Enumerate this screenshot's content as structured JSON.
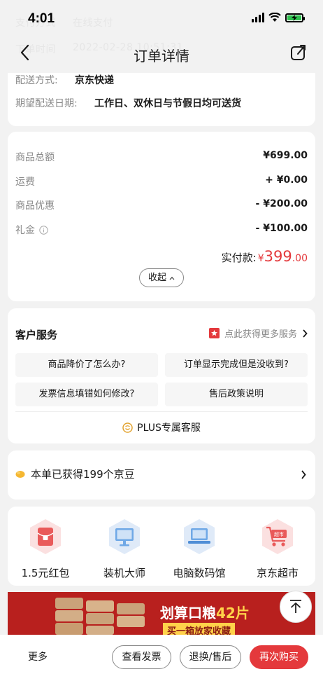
{
  "status_bar": {
    "time": "4:01"
  },
  "ghost": {
    "pay_label": "支付方式",
    "pay_value": "在线支付",
    "time_label": "下单时间",
    "time_value": "2022-02-28 10:51:31"
  },
  "nav": {
    "title": "订单详情"
  },
  "delivery": {
    "method_label": "配送方式:",
    "method_value": "京东快递",
    "date_label": "期望配送日期:",
    "date_value": "工作日、双休日与节假日均可送货"
  },
  "amounts": {
    "rows": [
      {
        "label": "商品总额",
        "value": "¥699.00"
      },
      {
        "label": "运费",
        "value": "+ ¥0.00"
      },
      {
        "label": "商品优惠",
        "value": "- ¥200.00"
      },
      {
        "label": "礼金",
        "value": "- ¥100.00"
      }
    ],
    "paid_label": "实付款:",
    "paid_currency": "¥",
    "paid_integer": "399",
    "paid_decimal": ".00",
    "collapse_label": "收起"
  },
  "customer_service": {
    "title": "客户服务",
    "more_label": "点此获得更多服务",
    "buttons": [
      "商品降价了怎么办?",
      "订单显示完成但是没收到?",
      "发票信息填错如何修改?",
      "售后政策说明"
    ],
    "plus_label": "PLUS专属客服"
  },
  "beans": {
    "text": "本单已获得199个京豆"
  },
  "tiles": [
    {
      "label": "1.5元红包",
      "icon": "red-packet-icon",
      "color": "#f26b6b"
    },
    {
      "label": "装机大师",
      "icon": "monitor-icon",
      "color": "#6fa8e6"
    },
    {
      "label": "电脑数码馆",
      "icon": "laptop-icon",
      "color": "#6fa8e6"
    },
    {
      "label": "京东超市",
      "icon": "cart-icon",
      "color": "#f26b6b",
      "badge": "超市"
    }
  ],
  "banner": {
    "title_prefix": "划算口粮",
    "title_highlight": "42片",
    "subtitle": "买一箱放家收藏"
  },
  "bottom_bar": {
    "more": "更多",
    "invoice": "查看发票",
    "return": "退换/售后",
    "rebuy": "再次购买"
  },
  "colors": {
    "accent": "#e4393c",
    "bean": "#f5b731"
  }
}
